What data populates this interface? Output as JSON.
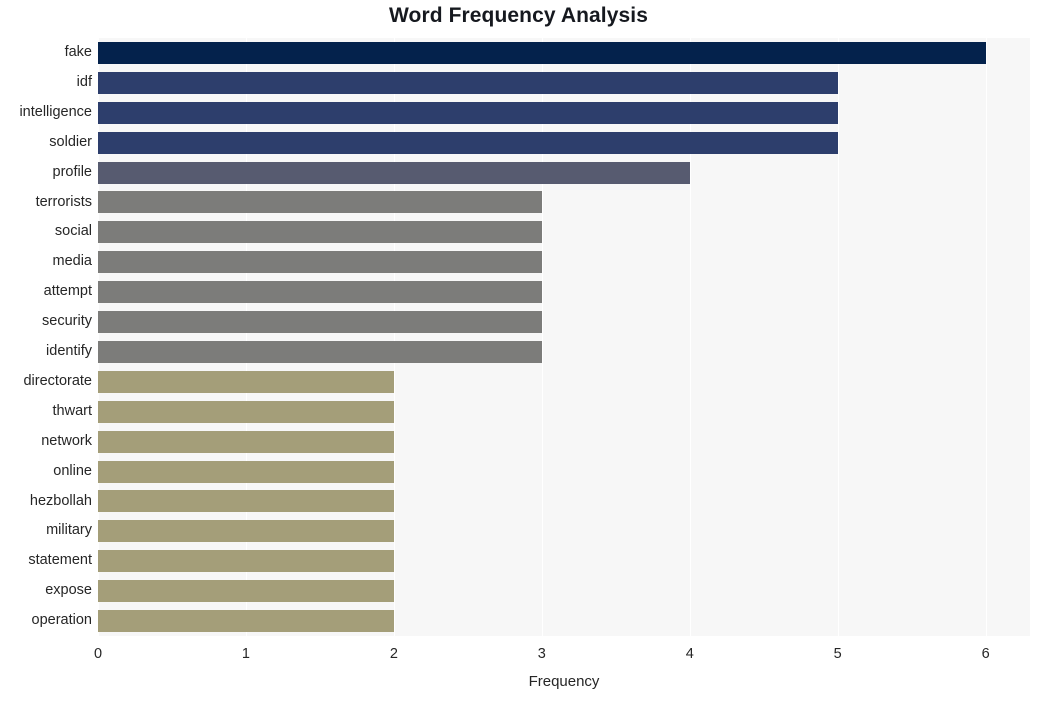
{
  "chart_data": {
    "type": "bar",
    "orientation": "horizontal",
    "title": "Word Frequency Analysis",
    "xlabel": "Frequency",
    "ylabel": "",
    "xlim": [
      0,
      6.3
    ],
    "ylim": null,
    "grid": true,
    "legend": null,
    "xticks": [
      "0",
      "1",
      "2",
      "3",
      "4",
      "5",
      "6"
    ],
    "xtick_values": [
      0,
      1,
      2,
      3,
      4,
      5,
      6
    ],
    "categories": [
      "fake",
      "idf",
      "intelligence",
      "soldier",
      "profile",
      "terrorists",
      "social",
      "media",
      "attempt",
      "security",
      "identify",
      "directorate",
      "thwart",
      "network",
      "online",
      "hezbollah",
      "military",
      "statement",
      "expose",
      "operation"
    ],
    "values": [
      6,
      5,
      5,
      5,
      4,
      3,
      3,
      3,
      3,
      3,
      3,
      2,
      2,
      2,
      2,
      2,
      2,
      2,
      2,
      2
    ],
    "bar_colors": [
      "#04224c",
      "#2d3e6c",
      "#2d3e6c",
      "#2d3e6c",
      "#575b70",
      "#7c7c7a",
      "#7c7c7a",
      "#7c7c7a",
      "#7c7c7a",
      "#7c7c7a",
      "#7c7c7a",
      "#a49e79",
      "#a49e79",
      "#a49e79",
      "#a49e79",
      "#a49e79",
      "#a49e79",
      "#a49e79",
      "#a49e79",
      "#a49e79"
    ]
  },
  "style": {
    "plot_background": "#f7f7f7",
    "figure_background": "#ffffff",
    "gridline_color": "#ffffff",
    "text_color": "#262626",
    "title_color": "#16191f"
  }
}
